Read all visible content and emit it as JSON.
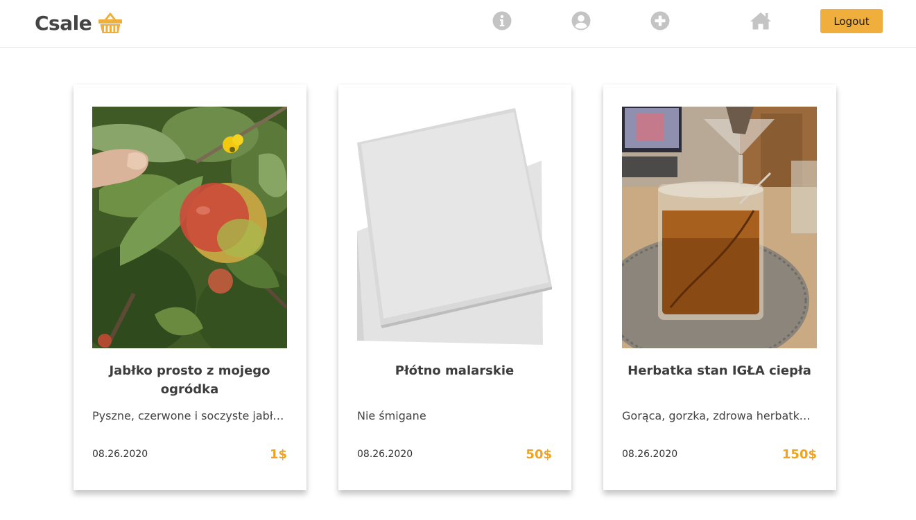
{
  "brand": {
    "name": "Csale",
    "icon": "basket-icon"
  },
  "nav": {
    "info_icon": "info-icon",
    "profile_icon": "user-circle-icon",
    "add_icon": "plus-circle-icon",
    "home_icon": "home-icon",
    "logout_label": "Logout"
  },
  "colors": {
    "accent": "#f0ae3c",
    "price": "#f0a31d",
    "icon_gray": "#c4c4c4"
  },
  "products": [
    {
      "title": "Jabłko prosto z mojego ogródka",
      "description": "Pyszne, czerwone i soczyste jabłuszko",
      "date": "08.26.2020",
      "price": "1$",
      "image": "apple-on-tree-photo"
    },
    {
      "title": "Płótno malarskie",
      "description": "Nie śmigane",
      "date": "08.26.2020",
      "price": "50$",
      "image": "white-canvas-photo"
    },
    {
      "title": "Herbatka stan IGŁA ciepła",
      "description": "Gorąca, gorzka, zdrowa herbatka, pyszna",
      "date": "08.26.2020",
      "price": "150$",
      "image": "tea-glass-photo"
    }
  ]
}
